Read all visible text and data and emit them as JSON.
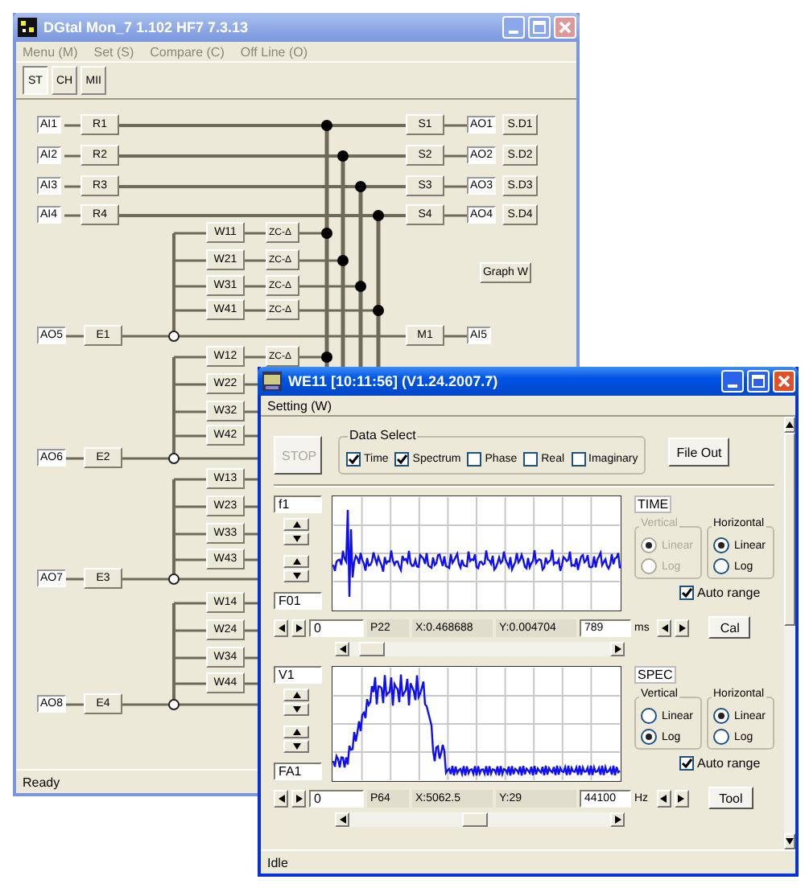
{
  "back_window": {
    "title": "DGtal Mon_7 1.102 HF7 7.3.13",
    "active": false,
    "menu": [
      "Menu (M)",
      "Set (S)",
      "Compare (C)",
      "Off Line (O)"
    ],
    "toolbar": [
      {
        "label": "ST",
        "selected": true
      },
      {
        "label": "CH",
        "selected": false
      },
      {
        "label": "MII",
        "selected": false
      }
    ],
    "channels": [
      {
        "input": "AI1",
        "module": "R1",
        "output_module": "S1",
        "output": "AO1",
        "sd": "S.D1"
      },
      {
        "input": "AI2",
        "module": "R2",
        "output_module": "S2",
        "output": "AO2",
        "sd": "S.D2"
      },
      {
        "input": "AI3",
        "module": "R3",
        "output_module": "S3",
        "output": "AO3",
        "sd": "S.D3"
      },
      {
        "input": "AI4",
        "module": "R4",
        "output_module": "S4",
        "output": "AO4",
        "sd": "S.D4"
      }
    ],
    "groups": [
      {
        "weights": [
          {
            "label": "W11",
            "filter": "ZC-Δ"
          },
          {
            "label": "W21",
            "filter": "ZC-Δ"
          },
          {
            "label": "W31",
            "filter": "ZC-Δ"
          },
          {
            "label": "W41",
            "filter": "ZC-Δ"
          }
        ],
        "source": "AO5",
        "module": "E1",
        "output_module": "M1",
        "output": "AI5"
      },
      {
        "weights": [
          {
            "label": "W12",
            "filter": "ZC-Δ"
          },
          {
            "label": "W22"
          },
          {
            "label": "W32"
          },
          {
            "label": "W42"
          }
        ],
        "source": "AO6",
        "module": "E2"
      },
      {
        "weights": [
          {
            "label": "W13"
          },
          {
            "label": "W23"
          },
          {
            "label": "W33"
          },
          {
            "label": "W43"
          }
        ],
        "source": "AO7",
        "module": "E3"
      },
      {
        "weights": [
          {
            "label": "W14"
          },
          {
            "label": "W24"
          },
          {
            "label": "W34"
          },
          {
            "label": "W44"
          }
        ],
        "source": "AO8",
        "module": "E4"
      }
    ],
    "graph_button": "Graph W",
    "status": "Ready"
  },
  "front_window": {
    "title": "WE11 [10:11:56]   (V1.24.2007.7)",
    "active": true,
    "menu": [
      "Setting (W)"
    ],
    "stop_button": {
      "label": "STOP",
      "disabled": true
    },
    "data_select": {
      "title": "Data Select",
      "options": [
        {
          "label": "Time",
          "checked": true
        },
        {
          "label": "Spectrum",
          "checked": true
        },
        {
          "label": "Phase",
          "checked": false
        },
        {
          "label": "Real",
          "checked": false
        },
        {
          "label": "Imaginary",
          "checked": false
        }
      ]
    },
    "file_out": "File Out",
    "panels": [
      {
        "kind": "time",
        "channel": "f1",
        "range_label": "F01",
        "name": "TIME",
        "vertical": {
          "title": "Vertical",
          "disabled": true,
          "options": [
            {
              "label": "Linear",
              "selected": true
            },
            {
              "label": "Log",
              "selected": false
            }
          ]
        },
        "horizontal": {
          "title": "Horizontal",
          "disabled": false,
          "options": [
            {
              "label": "Linear",
              "selected": true
            },
            {
              "label": "Log",
              "selected": false
            }
          ]
        },
        "auto_range": {
          "label": "Auto range",
          "checked": true
        },
        "start": "0",
        "point": "P22",
        "x": "X:0.468688",
        "y": "Y:0.004704",
        "end": "789",
        "unit": "ms",
        "button": "Cal"
      },
      {
        "kind": "spectrum",
        "channel": "V1",
        "range_label": "FA1",
        "name": "SPEC",
        "vertical": {
          "title": "Vertical",
          "disabled": false,
          "options": [
            {
              "label": "Linear",
              "selected": false
            },
            {
              "label": "Log",
              "selected": true
            }
          ]
        },
        "horizontal": {
          "title": "Horizontal",
          "disabled": false,
          "options": [
            {
              "label": "Linear",
              "selected": true
            },
            {
              "label": "Log",
              "selected": false
            }
          ]
        },
        "auto_range": {
          "label": "Auto range",
          "checked": true
        },
        "start": "0",
        "point": "P64",
        "x": "X:5062.5",
        "y": "Y:29",
        "end": "44100",
        "unit": "Hz",
        "button": "Tool"
      }
    ],
    "status": "Idle"
  }
}
